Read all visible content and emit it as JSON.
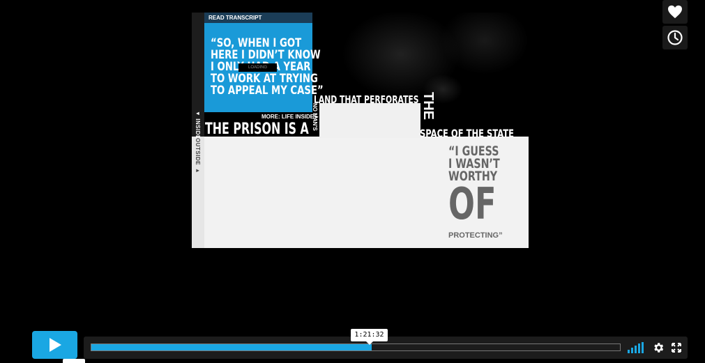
{
  "video": {
    "read_transcript": "READ TRANSCRIPT",
    "quote_blue_lines": [
      "“SO, WHEN I GOT",
      "HERE I DIDN’T KNOW",
      "I ONLY HAD A YEAR",
      "TO WORK AT TRYING",
      "TO APPEAL MY CASE”"
    ],
    "loading": "LOADING",
    "more_link": "MORE: LIFE INSIDE ▸",
    "inside_tab": "◂ INSIDE",
    "outside_tab": "OUTSIDE ▸",
    "prison_text": "THE PRISON IS A",
    "nomans_text": "NO MAN'S",
    "land_text": "LAND THAT PERFORATES",
    "the_text": "THE",
    "state_text": "SPACE OF THE STATE",
    "quote_gray_lines": [
      "“I GUESS",
      "I WASN’T",
      "WORTHY"
    ],
    "of_text": "OF",
    "protecting_text": "PROTECTING”"
  },
  "controls": {
    "time_tooltip": "1:21:32",
    "progress_fraction": 0.53,
    "accent_color": "#1aa7e3"
  },
  "icons": {
    "like": "heart-icon",
    "watch_later": "clock-icon",
    "play": "play-icon",
    "volume": "volume-bars-icon",
    "settings": "gear-icon",
    "fullscreen": "fullscreen-icon"
  }
}
